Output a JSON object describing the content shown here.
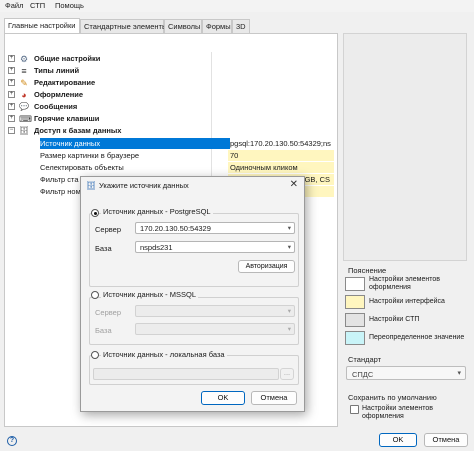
{
  "menu": [
    "Файл",
    "СТП",
    "Помощь"
  ],
  "tabs": [
    "Главные настройки",
    "Стандартные элементы",
    "Символы",
    "Формы",
    "3D"
  ],
  "tree": [
    {
      "label": "Общие настройки",
      "expander": "+",
      "icon": "settings-icon",
      "glyph": "⚙"
    },
    {
      "label": "Типы линий",
      "expander": "+",
      "icon": "lines-icon",
      "glyph": "≡"
    },
    {
      "label": "Редактирование",
      "expander": "+",
      "icon": "pencil-icon",
      "glyph": "✎"
    },
    {
      "label": "Оформление",
      "expander": "+",
      "icon": "palette-icon",
      "glyph": "◕"
    },
    {
      "label": "Сообщения",
      "expander": "+",
      "icon": "message-icon",
      "glyph": "💬"
    },
    {
      "label": "Горячие клавиши",
      "expander": "+",
      "icon": "keyboard-icon",
      "glyph": "⌨"
    },
    {
      "label": "Доступ к базам данных",
      "expander": "−",
      "icon": "database-icon",
      "glyph": "🗄"
    }
  ],
  "properties": [
    {
      "name": "Источник данных",
      "value": "pgsql:170.20.130.50:54329;ns",
      "selected": true,
      "highlight": false,
      "button": "..."
    },
    {
      "name": "Размер картинки в браузере",
      "value": "70",
      "selected": false,
      "highlight": true
    },
    {
      "name": "Селектировать объекты",
      "value": "Одиночным кликом",
      "selected": false,
      "highlight": true
    },
    {
      "name": "Фильтр ста",
      "value": "; GB, CS",
      "selected": false,
      "highlight": true
    },
    {
      "name": "Фильтр ном",
      "value": "",
      "selected": false,
      "highlight": false
    }
  ],
  "legend": {
    "title": "Пояснение",
    "items": [
      {
        "text": "Настройки элементов оформления",
        "color": "#ffffff",
        "swatch_icon": "white-swatch"
      },
      {
        "text": "Настройки интерфейса",
        "color": "#fff6bf",
        "swatch_icon": "yellow-swatch"
      },
      {
        "text": "Настройки СТП",
        "color": "#e3e3e3",
        "swatch_icon": "gray-swatch"
      },
      {
        "text": "Переопределенное значение",
        "color": "#c9f4f8",
        "swatch_icon": "cyan-swatch"
      }
    ]
  },
  "standard": {
    "title": "Стандарт",
    "value": "СПДС"
  },
  "defaults": {
    "title": "Сохранить по умолчанию",
    "checkbox_label": "Настройки элементов оформления"
  },
  "main_buttons": {
    "ok": "OK",
    "cancel": "Отмена"
  },
  "help_glyph": "?",
  "dialog": {
    "title": "Укажите источник данных",
    "close": "✕",
    "pg": {
      "legend": "Источник данных - PostgreSQL",
      "server_label": "Сервер",
      "server_value": "170.20.130.50:54329",
      "db_label": "База",
      "db_value": "nspds231",
      "auth_button": "Авторизация"
    },
    "mssql": {
      "legend": "Источник данных - MSSQL",
      "server_label": "Сервер",
      "db_label": "База"
    },
    "local": {
      "legend": "Источник данных - локальная база",
      "browse": "..."
    },
    "ok": "OK",
    "cancel": "Отмена"
  },
  "colors": {
    "accent": "#0078d7",
    "interface_highlight": "#fff6bf"
  }
}
